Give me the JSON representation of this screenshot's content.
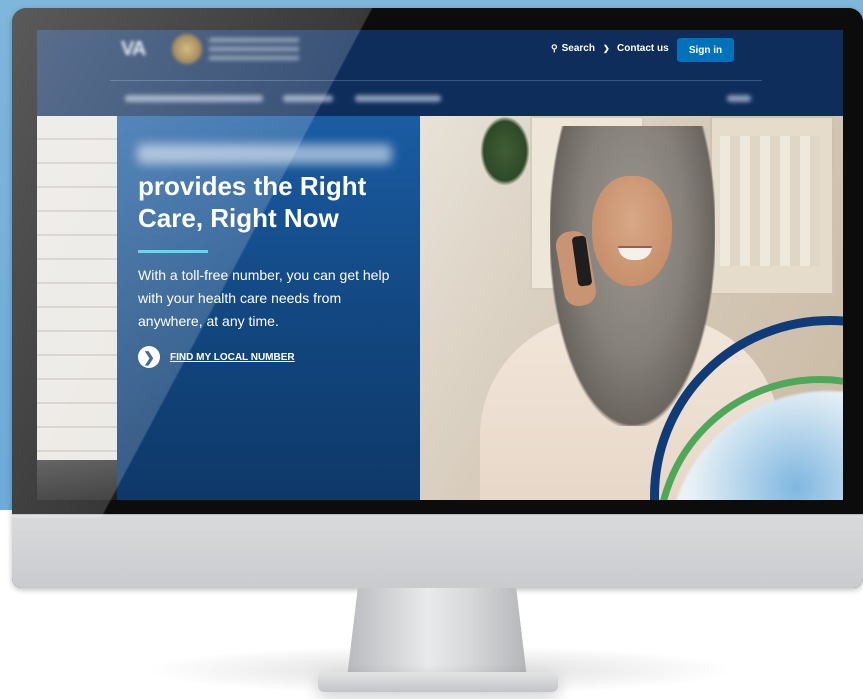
{
  "header": {
    "logo": "VA",
    "search_label": "Search",
    "contact_label": "Contact us",
    "signin_label": "Sign in"
  },
  "hero": {
    "headline": "provides the Right Care, Right Now",
    "description": "With a toll-free number, you can get help with your health care needs from anywhere, at any time.",
    "cta_label": "FIND MY LOCAL NUMBER"
  },
  "colors": {
    "header_bg": "#0f2d5a",
    "signin_bg": "#0071bb",
    "panel_bg": "#12467f",
    "accent": "#4ec3e8",
    "arc_green": "#4fa85a",
    "arc_blue": "#0f3c78"
  },
  "icons": {
    "search": "search-icon",
    "dropdown": "chevron-down-icon",
    "cta": "chevron-right-circle-icon"
  }
}
